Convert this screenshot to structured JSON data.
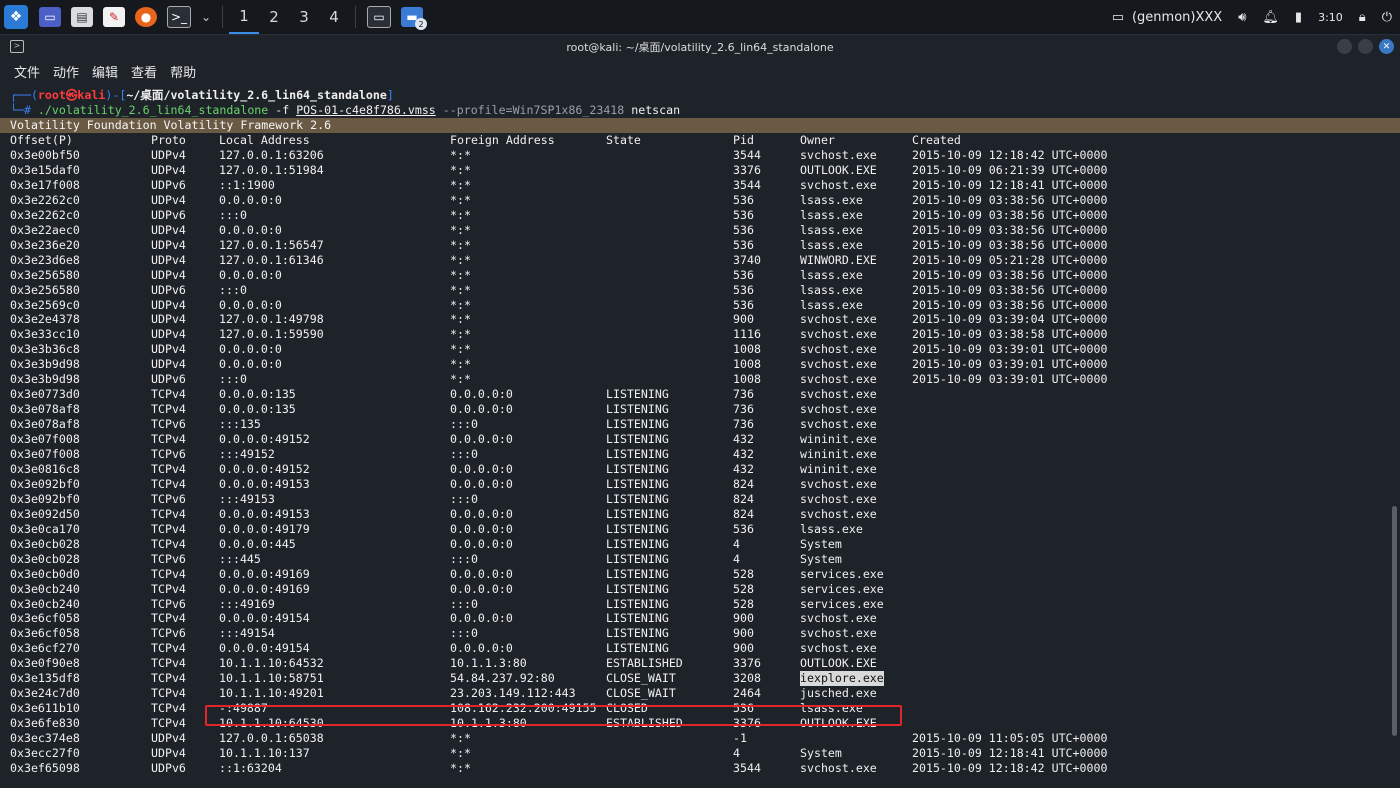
{
  "taskbar": {
    "workspaces": [
      "1",
      "2",
      "3",
      "4"
    ],
    "active_workspace": "1",
    "terminal_badge": "2",
    "genmon": "(genmon)XXX",
    "clock": "3:10"
  },
  "window": {
    "title": "root@kali: ~/桌面/volatility_2.6_lin64_standalone",
    "menu": [
      "文件",
      "动作",
      "编辑",
      "查看",
      "帮助"
    ]
  },
  "terminal": {
    "prompt_line": {
      "start": "┌──(",
      "user_host": "root㉿kali",
      "mid": ")-[",
      "path": "~/桌面/volatility_2.6_lin64_standalone",
      "end": "]"
    },
    "command_line": {
      "start": "└─# ",
      "exe": "./volatility_2.6_lin64_standalone",
      "flag_f": " -f ",
      "file": "POS-01-c4e8f786.vmss",
      "profile": " --profile=Win7SP1x86_23418",
      "plugin": " netscan"
    },
    "banner": "Volatility Foundation Volatility Framework 2.6",
    "columns": [
      "Offset(P)",
      "Proto",
      "Local Address",
      "Foreign Address",
      "State",
      "Pid",
      "Owner",
      "Created"
    ],
    "rows": [
      [
        "0x3e00bf50",
        "UDPv4",
        "127.0.0.1:63206",
        "*:*",
        "",
        "3544",
        "svchost.exe",
        "2015-10-09 12:18:42 UTC+0000"
      ],
      [
        "0x3e15daf0",
        "UDPv4",
        "127.0.0.1:51984",
        "*:*",
        "",
        "3376",
        "OUTLOOK.EXE",
        "2015-10-09 06:21:39 UTC+0000"
      ],
      [
        "0x3e17f008",
        "UDPv6",
        "::1:1900",
        "*:*",
        "",
        "3544",
        "svchost.exe",
        "2015-10-09 12:18:41 UTC+0000"
      ],
      [
        "0x3e2262c0",
        "UDPv4",
        "0.0.0.0:0",
        "*:*",
        "",
        "536",
        "lsass.exe",
        "2015-10-09 03:38:56 UTC+0000"
      ],
      [
        "0x3e2262c0",
        "UDPv6",
        ":::0",
        "*:*",
        "",
        "536",
        "lsass.exe",
        "2015-10-09 03:38:56 UTC+0000"
      ],
      [
        "0x3e22aec0",
        "UDPv4",
        "0.0.0.0:0",
        "*:*",
        "",
        "536",
        "lsass.exe",
        "2015-10-09 03:38:56 UTC+0000"
      ],
      [
        "0x3e236e20",
        "UDPv4",
        "127.0.0.1:56547",
        "*:*",
        "",
        "536",
        "lsass.exe",
        "2015-10-09 03:38:56 UTC+0000"
      ],
      [
        "0x3e23d6e8",
        "UDPv4",
        "127.0.0.1:61346",
        "*:*",
        "",
        "3740",
        "WINWORD.EXE",
        "2015-10-09 05:21:28 UTC+0000"
      ],
      [
        "0x3e256580",
        "UDPv4",
        "0.0.0.0:0",
        "*:*",
        "",
        "536",
        "lsass.exe",
        "2015-10-09 03:38:56 UTC+0000"
      ],
      [
        "0x3e256580",
        "UDPv6",
        ":::0",
        "*:*",
        "",
        "536",
        "lsass.exe",
        "2015-10-09 03:38:56 UTC+0000"
      ],
      [
        "0x3e2569c0",
        "UDPv4",
        "0.0.0.0:0",
        "*:*",
        "",
        "536",
        "lsass.exe",
        "2015-10-09 03:38:56 UTC+0000"
      ],
      [
        "0x3e2e4378",
        "UDPv4",
        "127.0.0.1:49798",
        "*:*",
        "",
        "900",
        "svchost.exe",
        "2015-10-09 03:39:04 UTC+0000"
      ],
      [
        "0x3e33cc10",
        "UDPv4",
        "127.0.0.1:59590",
        "*:*",
        "",
        "1116",
        "svchost.exe",
        "2015-10-09 03:38:58 UTC+0000"
      ],
      [
        "0x3e3b36c8",
        "UDPv4",
        "0.0.0.0:0",
        "*:*",
        "",
        "1008",
        "svchost.exe",
        "2015-10-09 03:39:01 UTC+0000"
      ],
      [
        "0x3e3b9d98",
        "UDPv4",
        "0.0.0.0:0",
        "*:*",
        "",
        "1008",
        "svchost.exe",
        "2015-10-09 03:39:01 UTC+0000"
      ],
      [
        "0x3e3b9d98",
        "UDPv6",
        ":::0",
        "*:*",
        "",
        "1008",
        "svchost.exe",
        "2015-10-09 03:39:01 UTC+0000"
      ],
      [
        "0x3e0773d0",
        "TCPv4",
        "0.0.0.0:135",
        "0.0.0.0:0",
        "LISTENING",
        "736",
        "svchost.exe",
        ""
      ],
      [
        "0x3e078af8",
        "TCPv4",
        "0.0.0.0:135",
        "0.0.0.0:0",
        "LISTENING",
        "736",
        "svchost.exe",
        ""
      ],
      [
        "0x3e078af8",
        "TCPv6",
        ":::135",
        ":::0",
        "LISTENING",
        "736",
        "svchost.exe",
        ""
      ],
      [
        "0x3e07f008",
        "TCPv4",
        "0.0.0.0:49152",
        "0.0.0.0:0",
        "LISTENING",
        "432",
        "wininit.exe",
        ""
      ],
      [
        "0x3e07f008",
        "TCPv6",
        ":::49152",
        ":::0",
        "LISTENING",
        "432",
        "wininit.exe",
        ""
      ],
      [
        "0x3e0816c8",
        "TCPv4",
        "0.0.0.0:49152",
        "0.0.0.0:0",
        "LISTENING",
        "432",
        "wininit.exe",
        ""
      ],
      [
        "0x3e092bf0",
        "TCPv4",
        "0.0.0.0:49153",
        "0.0.0.0:0",
        "LISTENING",
        "824",
        "svchost.exe",
        ""
      ],
      [
        "0x3e092bf0",
        "TCPv6",
        ":::49153",
        ":::0",
        "LISTENING",
        "824",
        "svchost.exe",
        ""
      ],
      [
        "0x3e092d50",
        "TCPv4",
        "0.0.0.0:49153",
        "0.0.0.0:0",
        "LISTENING",
        "824",
        "svchost.exe",
        ""
      ],
      [
        "0x3e0ca170",
        "TCPv4",
        "0.0.0.0:49179",
        "0.0.0.0:0",
        "LISTENING",
        "536",
        "lsass.exe",
        ""
      ],
      [
        "0x3e0cb028",
        "TCPv4",
        "0.0.0.0:445",
        "0.0.0.0:0",
        "LISTENING",
        "4",
        "System",
        ""
      ],
      [
        "0x3e0cb028",
        "TCPv6",
        ":::445",
        ":::0",
        "LISTENING",
        "4",
        "System",
        ""
      ],
      [
        "0x3e0cb0d0",
        "TCPv4",
        "0.0.0.0:49169",
        "0.0.0.0:0",
        "LISTENING",
        "528",
        "services.exe",
        ""
      ],
      [
        "0x3e0cb240",
        "TCPv4",
        "0.0.0.0:49169",
        "0.0.0.0:0",
        "LISTENING",
        "528",
        "services.exe",
        ""
      ],
      [
        "0x3e0cb240",
        "TCPv6",
        ":::49169",
        ":::0",
        "LISTENING",
        "528",
        "services.exe",
        ""
      ],
      [
        "0x3e6cf058",
        "TCPv4",
        "0.0.0.0:49154",
        "0.0.0.0:0",
        "LISTENING",
        "900",
        "svchost.exe",
        ""
      ],
      [
        "0x3e6cf058",
        "TCPv6",
        ":::49154",
        ":::0",
        "LISTENING",
        "900",
        "svchost.exe",
        ""
      ],
      [
        "0x3e6cf270",
        "TCPv4",
        "0.0.0.0:49154",
        "0.0.0.0:0",
        "LISTENING",
        "900",
        "svchost.exe",
        ""
      ],
      [
        "0x3e0f90e8",
        "TCPv4",
        "10.1.1.10:64532",
        "10.1.1.3:80",
        "ESTABLISHED",
        "3376",
        "OUTLOOK.EXE",
        ""
      ],
      [
        "0x3e135df8",
        "TCPv4",
        "10.1.1.10:58751",
        "54.84.237.92:80",
        "CLOSE_WAIT",
        "3208",
        "iexplore.exe",
        ""
      ],
      [
        "0x3e24c7d0",
        "TCPv4",
        "10.1.1.10:49201",
        "23.203.149.112:443",
        "CLOSE_WAIT",
        "2464",
        "jusched.exe",
        ""
      ],
      [
        "0x3e611b10",
        "TCPv4",
        "-:49887",
        "108.162.232.200:49155",
        "CLOSED",
        "536",
        "lsass.exe",
        ""
      ],
      [
        "0x3e6fe830",
        "TCPv4",
        "10.1.1.10:64530",
        "10.1.1.3:80",
        "ESTABLISHED",
        "3376",
        "OUTLOOK.EXE",
        ""
      ],
      [
        "0x3ec374e8",
        "UDPv4",
        "127.0.0.1:65038",
        "*:*",
        "",
        "-1",
        "",
        "2015-10-09 11:05:05 UTC+0000"
      ],
      [
        "0x3ecc27f0",
        "UDPv4",
        "10.1.1.10:137",
        "*:*",
        "",
        "4",
        "System",
        "2015-10-09 12:18:41 UTC+0000"
      ],
      [
        "0x3ef65098",
        "UDPv6",
        "::1:63204",
        "*:*",
        "",
        "3544",
        "svchost.exe",
        "2015-10-09 12:18:42 UTC+0000"
      ]
    ],
    "highlighted_row": 35
  }
}
